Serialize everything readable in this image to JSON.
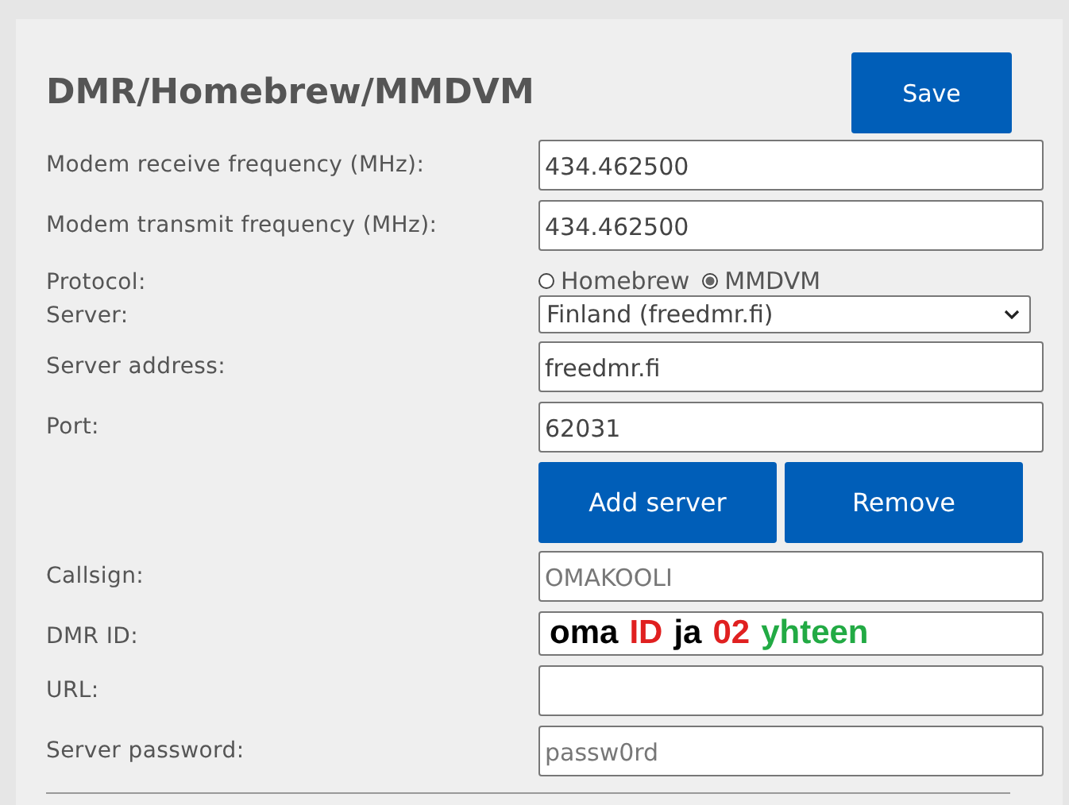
{
  "title": "DMR/Homebrew/MMDVM",
  "save_button": "Save",
  "fields": [
    {
      "kind": "input",
      "label": "Modem receive frequency (MHz):",
      "value": "434.462500"
    },
    {
      "kind": "input",
      "label": "Modem transmit frequency (MHz):",
      "value": "434.462500"
    },
    {
      "kind": "radio",
      "label": "Protocol:",
      "options": [
        {
          "label": "Homebrew",
          "selected": false
        },
        {
          "label": "MMDVM",
          "selected": true
        }
      ]
    },
    {
      "kind": "select",
      "label": "Server:",
      "value": "Finland (freedmr.fi)"
    },
    {
      "kind": "input",
      "label": "Server address:",
      "value": "freedmr.fi"
    },
    {
      "kind": "input",
      "label": "Port:",
      "value": "62031"
    },
    {
      "kind": "buttons",
      "buttons": [
        "Add server",
        "Remove"
      ]
    },
    {
      "kind": "input",
      "label": "Callsign:",
      "placeholder": "OMAKOOLI"
    },
    {
      "kind": "annotated",
      "label": "DMR ID:",
      "annotation": [
        {
          "text": "oma",
          "color": "#000000"
        },
        {
          "text": "ID",
          "color": "#e02020"
        },
        {
          "text": "ja",
          "color": "#000000"
        },
        {
          "text": "02",
          "color": "#e02020"
        },
        {
          "text": "yhteen",
          "color": "#22aa44"
        }
      ]
    },
    {
      "kind": "input",
      "label": "URL:"
    },
    {
      "kind": "input",
      "label": "Server password:",
      "placeholder": "passw0rd"
    }
  ]
}
